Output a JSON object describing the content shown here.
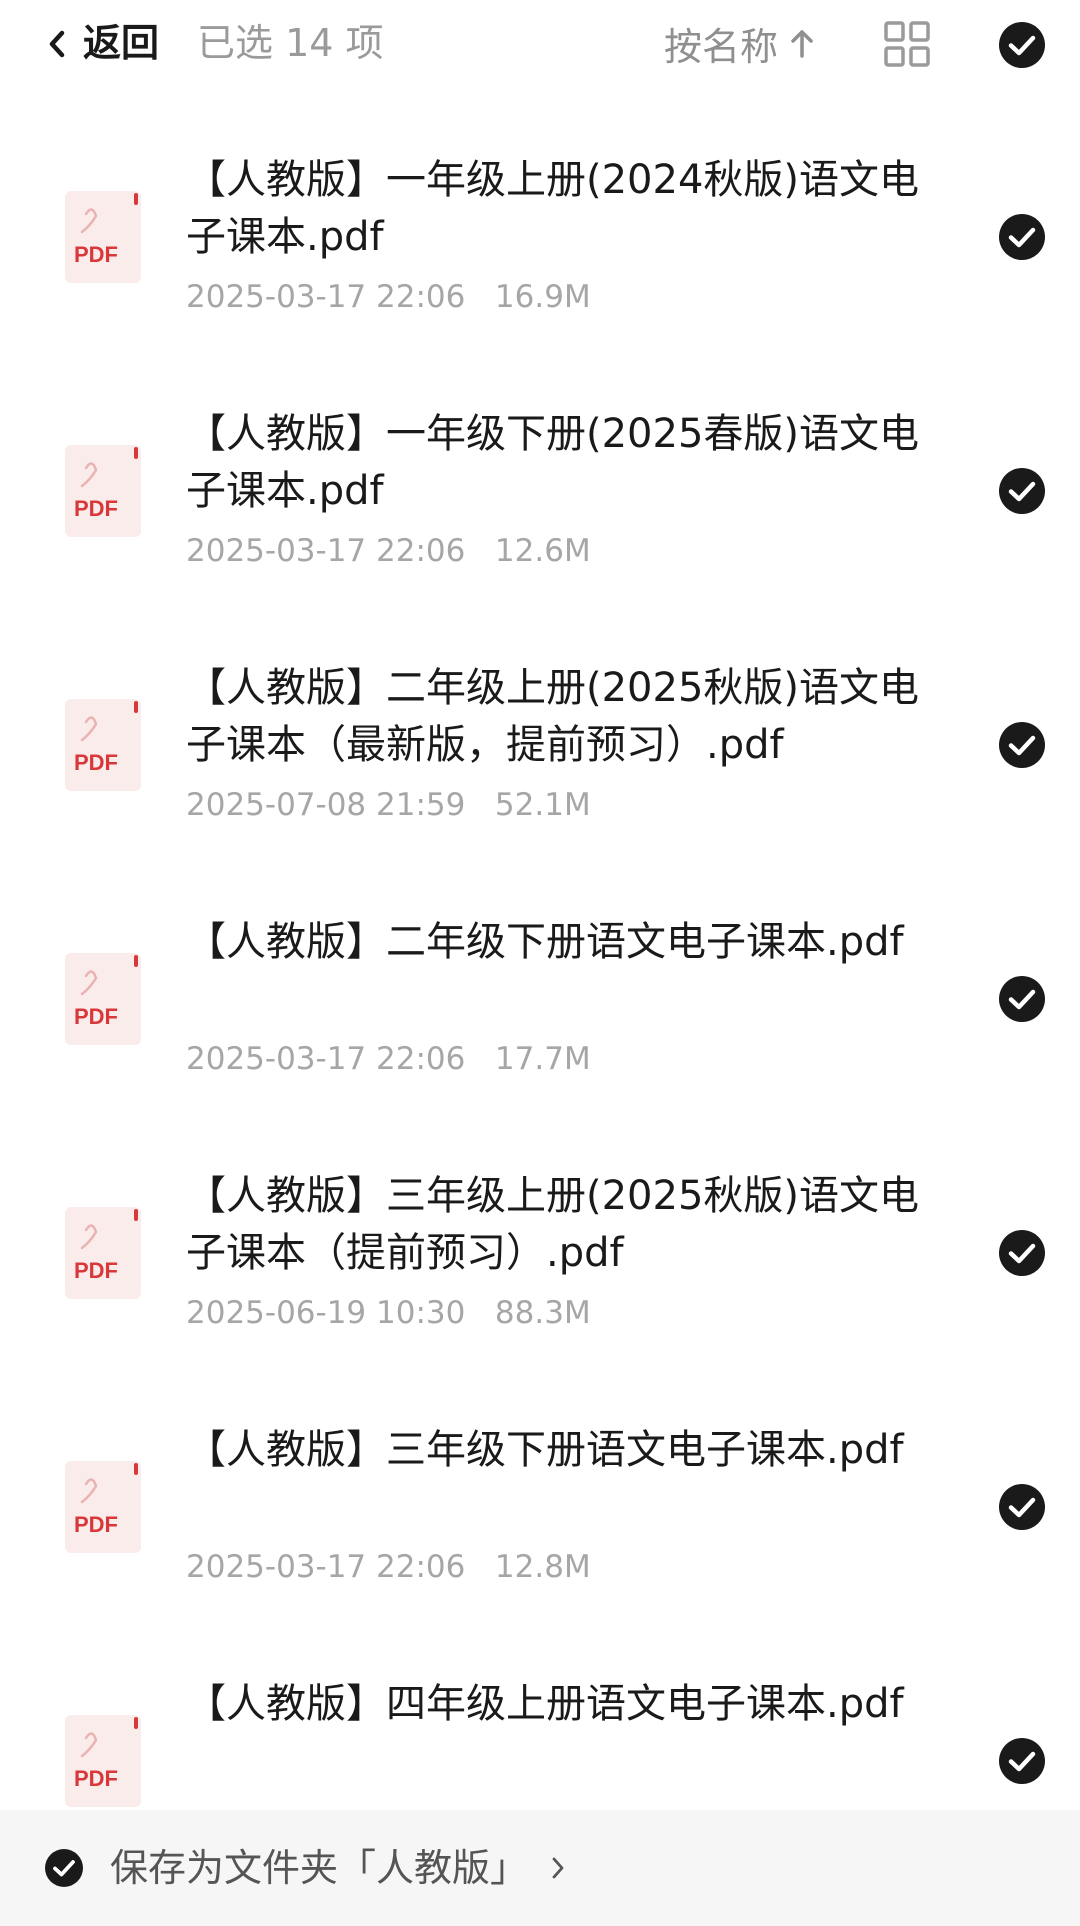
{
  "header": {
    "back_label": "返回",
    "selected_text": "已选 14 项",
    "sort_label": "按名称"
  },
  "icons": {
    "back": "chevron-left-icon",
    "sort": "arrow-up-icon",
    "view": "grid-icon",
    "check": "check-circle-icon",
    "file": "pdf-icon",
    "forward": "chevron-right-icon"
  },
  "colors": {
    "pdf_red": "#d9383a",
    "pdf_bg": "#fbeaea",
    "check_fill": "#1a1a1a",
    "meta_gray": "#a6a6a6"
  },
  "pdf_badge": "PDF",
  "files": [
    {
      "name": "【人教版】一年级上册(2024秋版)语文电子课本.pdf",
      "date": "2025-03-17 22:06",
      "size": "16.9M"
    },
    {
      "name": "【人教版】一年级下册(2025春版)语文电子课本.pdf",
      "date": "2025-03-17 22:06",
      "size": "12.6M"
    },
    {
      "name": "【人教版】二年级上册(2025秋版)语文电子课本（最新版，提前预习）.pdf",
      "date": "2025-07-08 21:59",
      "size": "52.1M"
    },
    {
      "name": "【人教版】二年级下册语文电子课本.pdf",
      "date": "2025-03-17 22:06",
      "size": "17.7M"
    },
    {
      "name": "【人教版】三年级上册(2025秋版)语文电子课本（提前预习）.pdf",
      "date": "2025-06-19 10:30",
      "size": "88.3M"
    },
    {
      "name": "【人教版】三年级下册语文电子课本.pdf",
      "date": "2025-03-17 22:06",
      "size": "12.8M"
    },
    {
      "name": "【人教版】四年级上册语文电子课本.pdf",
      "date": "",
      "size": ""
    }
  ],
  "bottom_bar": {
    "label": "保存为文件夹「人教版」"
  }
}
